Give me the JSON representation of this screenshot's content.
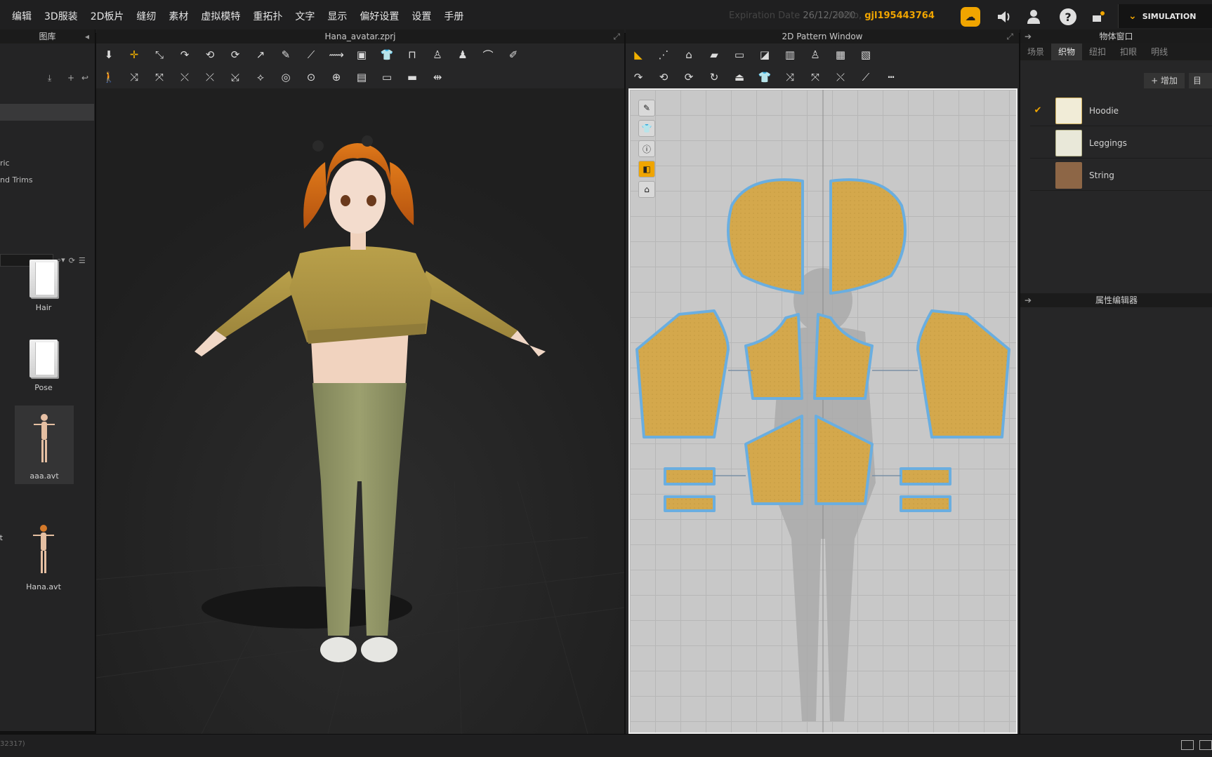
{
  "menu": [
    "编辑",
    "3D服装",
    "2D板片",
    "缝纫",
    "素材",
    "虚拟模特",
    "重拓扑",
    "文字",
    "显示",
    "偏好设置",
    "设置",
    "手册"
  ],
  "account": {
    "expiration_label": "Expiration Date",
    "expiration_value": "26/12/2020",
    "hello_label": "Hello,",
    "username": "gjl195443764"
  },
  "simulation_label": "SIMULATION",
  "library": {
    "title": "图库",
    "tree": [
      "ric",
      "nd Trims"
    ],
    "items": [
      {
        "label": "Hair",
        "kind": "folder"
      },
      {
        "label": "Pose",
        "kind": "folder"
      },
      {
        "label": "aaa.avt",
        "kind": "avatar"
      },
      {
        "label": "t",
        "kind": "avatar"
      },
      {
        "label": "Hana.avt",
        "kind": "avatar"
      }
    ]
  },
  "viewport3d": {
    "title": "Hana_avatar.zprj"
  },
  "pattern": {
    "title": "2D Pattern Window"
  },
  "object_window": {
    "title": "物体窗口",
    "tabs": [
      "场景",
      "织物",
      "纽扣",
      "扣眼",
      "明线"
    ],
    "active_tab": "织物",
    "add_label": "+ 增加",
    "add2_label": "目",
    "fabrics": [
      {
        "name": "Hoodie",
        "selected": true,
        "color": "#d8b86a"
      },
      {
        "name": "Leggings",
        "selected": false,
        "color": "#b6b48a"
      },
      {
        "name": "String",
        "selected": false,
        "color": "#8d6646"
      }
    ]
  },
  "property_editor": {
    "title": "属性编辑器"
  },
  "status": {
    "text": "32317)"
  },
  "colors": {
    "accent": "#f0a500",
    "fabric": "#d4a84c",
    "seam": "#6aaee0"
  }
}
